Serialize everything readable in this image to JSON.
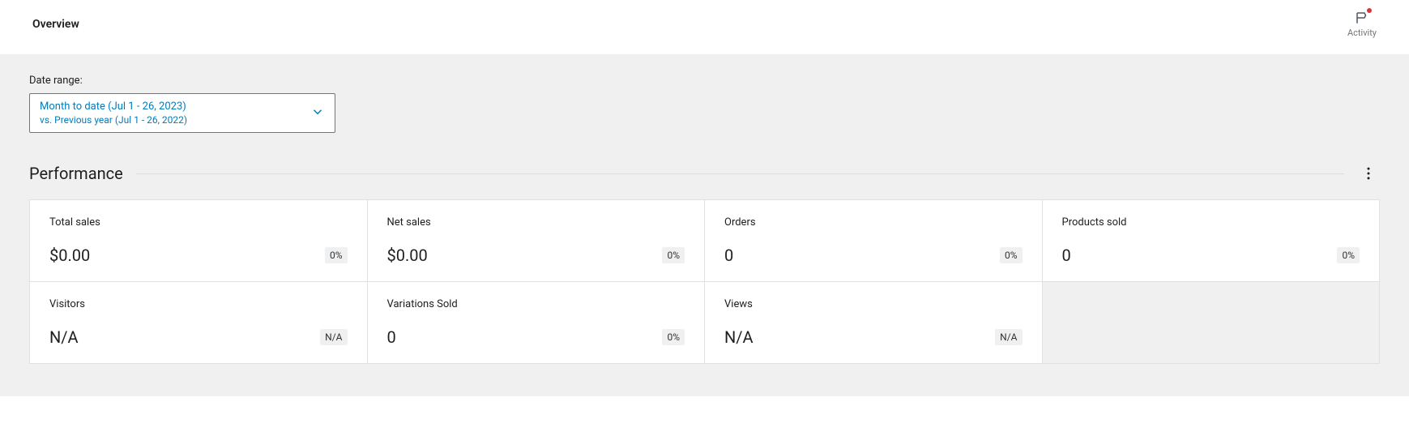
{
  "header": {
    "title": "Overview",
    "activity_label": "Activity"
  },
  "date_range": {
    "label": "Date range:",
    "primary": "Month to date (Jul 1 - 26, 2023)",
    "secondary": "vs. Previous year (Jul 1 - 26, 2022)"
  },
  "section": {
    "title": "Performance"
  },
  "cards": [
    {
      "label": "Total sales",
      "value": "$0.00",
      "badge": "0%"
    },
    {
      "label": "Net sales",
      "value": "$0.00",
      "badge": "0%"
    },
    {
      "label": "Orders",
      "value": "0",
      "badge": "0%"
    },
    {
      "label": "Products sold",
      "value": "0",
      "badge": "0%"
    },
    {
      "label": "Visitors",
      "value": "N/A",
      "badge": "N/A"
    },
    {
      "label": "Variations Sold",
      "value": "0",
      "badge": "0%"
    },
    {
      "label": "Views",
      "value": "N/A",
      "badge": "N/A"
    }
  ]
}
